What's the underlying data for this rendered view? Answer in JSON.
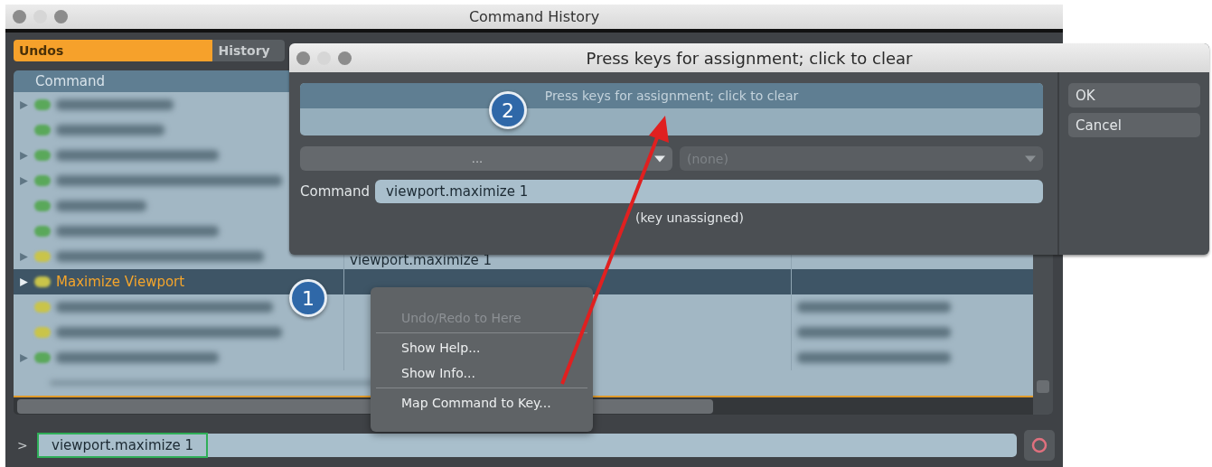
{
  "window": {
    "title": "Command History"
  },
  "tabs": [
    {
      "label": "Undos",
      "selected": true
    },
    {
      "label": "History",
      "selected": false
    }
  ],
  "table": {
    "columns": [
      "Command"
    ],
    "rows": [
      {
        "kind": "blurred",
        "expander": true,
        "selected": false,
        "color": "#5aa85a"
      },
      {
        "kind": "blurred",
        "expander": false,
        "selected": false,
        "color": "#5aa85a"
      },
      {
        "kind": "blurred",
        "expander": true,
        "selected": false,
        "color": "#5aa85a"
      },
      {
        "kind": "blurred",
        "expander": true,
        "selected": false,
        "color": "#5aa85a"
      },
      {
        "kind": "blurred",
        "expander": false,
        "selected": false,
        "color": "#5aa85a"
      },
      {
        "kind": "blurred",
        "expander": false,
        "selected": false,
        "color": "#5aa85a"
      },
      {
        "kind": "blurred",
        "expander": true,
        "selected": false,
        "color": "#c9c44a",
        "column_2": "viewport.maximize 1"
      },
      {
        "kind": "named",
        "label": "Maximize Viewport",
        "expander": true,
        "selected": true,
        "color": "#c9c44a"
      },
      {
        "kind": "blurred",
        "expander": false,
        "selected": false,
        "color": "#c9c44a",
        "column_3_blurred": true
      },
      {
        "kind": "blurred",
        "expander": false,
        "selected": false,
        "color": "#c9c44a",
        "column_3_blurred": true
      },
      {
        "kind": "blurred",
        "expander": true,
        "selected": false,
        "color": "#5aa85a",
        "column_3_blurred": true
      },
      {
        "kind": "divider",
        "selected": false
      }
    ]
  },
  "command_line": {
    "prompt": ">",
    "value": "viewport.maximize 1",
    "highlighted": true
  },
  "dialog": {
    "title": "Press keys for assignment; click to clear",
    "key_field": {
      "label": "Press keys for assignment; click to clear"
    },
    "dropdowns": [
      {
        "value": "...",
        "disabled": false
      },
      {
        "value": "(none)",
        "disabled": true
      }
    ],
    "command": {
      "label": "Command",
      "value": "viewport.maximize 1"
    },
    "status": "(key unassigned)",
    "buttons": [
      "OK",
      "Cancel"
    ]
  },
  "context_menu": {
    "items": [
      {
        "label": "Undo/Redo to Here",
        "disabled": true,
        "separator_after": true
      },
      {
        "label": "Show Help...",
        "disabled": false,
        "separator_after": false
      },
      {
        "label": "Show Info...",
        "disabled": false,
        "separator_after": true
      },
      {
        "label": "Map Command to Key...",
        "disabled": false,
        "separator_after": false
      }
    ]
  },
  "callouts": [
    "1",
    "2"
  ]
}
